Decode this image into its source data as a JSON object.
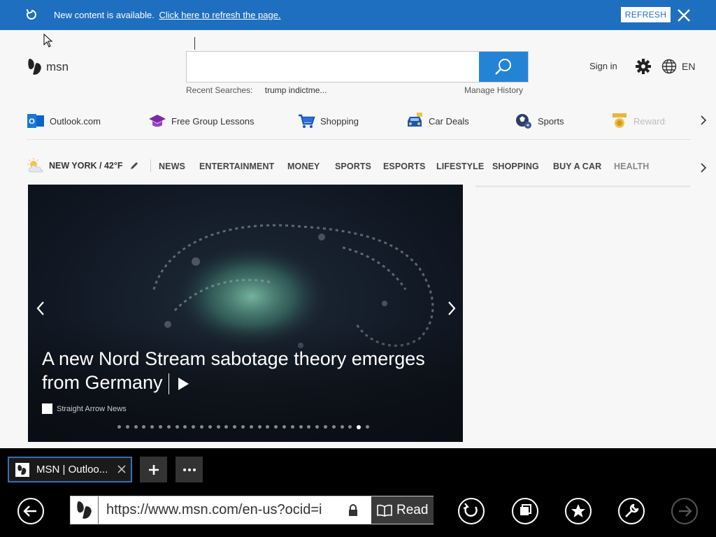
{
  "notification": {
    "message": "New content is available.",
    "link": "Click here to refresh the page.",
    "refresh_button": "REFRESH"
  },
  "header": {
    "logo_text": "msn",
    "search": {
      "value": "",
      "placeholder": ""
    },
    "recent_label": "Recent Searches:",
    "recent_value": "trump indictme...",
    "manage_history": "Manage History",
    "sign_in": "Sign in",
    "language": "EN"
  },
  "quick_links": [
    {
      "label": "Outlook.com",
      "icon": "outlook-icon"
    },
    {
      "label": "Free Group Lessons",
      "icon": "graduation-cap-icon"
    },
    {
      "label": "Shopping",
      "icon": "shopping-cart-icon"
    },
    {
      "label": "Car Deals",
      "icon": "car-icon"
    },
    {
      "label": "Sports",
      "icon": "soccer-ball-icon"
    },
    {
      "label": "Rewards",
      "icon": "medal-icon"
    }
  ],
  "weather": {
    "location": "NEW YORK / 42°F"
  },
  "nav": [
    "NEWS",
    "ENTERTAINMENT",
    "MONEY",
    "SPORTS",
    "ESPORTS",
    "LIFESTYLE",
    "SHOPPING",
    "BUY A CAR",
    "HEALTH"
  ],
  "hero": {
    "headline": "A new Nord Stream sabotage theory emerges from Germany",
    "source": "Straight Arrow News",
    "slide_count": 31,
    "active_slide": 29
  },
  "browser": {
    "tab_title": "MSN | Outloo...",
    "url": "https://www.msn.com/en-us?ocid=i",
    "read_label": "Read"
  },
  "colors": {
    "notification_bg": "#1e6fbf",
    "search_button": "#2384d6",
    "tab_border": "#3b6cb9"
  }
}
